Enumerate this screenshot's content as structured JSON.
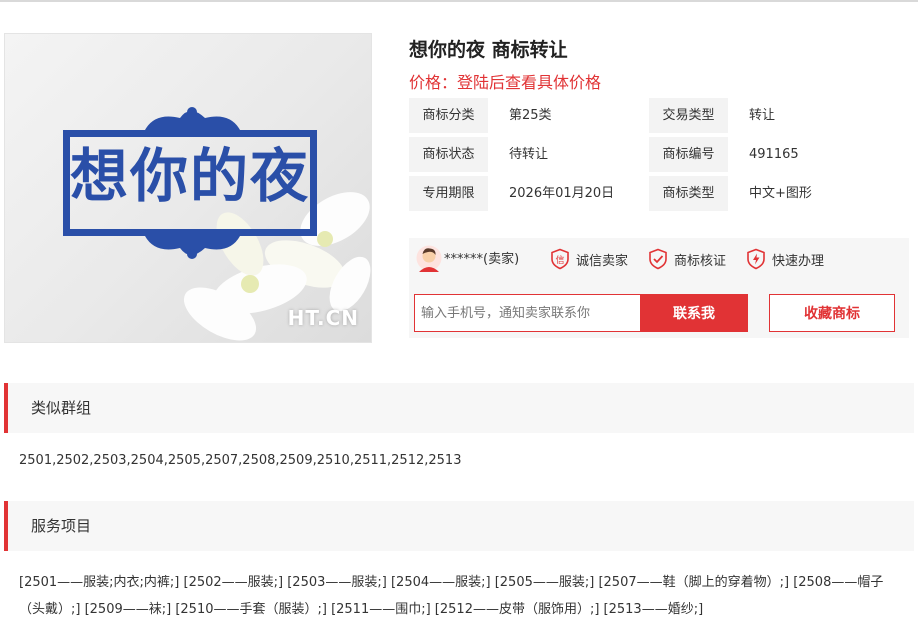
{
  "product": {
    "logo_text": "想你的夜",
    "watermark": "HT.CN",
    "title": "想你的夜 商标转让",
    "price_label": "价格：",
    "price_value": "登陆后查看具体价格"
  },
  "attributes": [
    [
      {
        "label": "商标分类",
        "value": "第25类"
      },
      {
        "label": "交易类型",
        "value": "转让"
      }
    ],
    [
      {
        "label": "商标状态",
        "value": "待转让"
      },
      {
        "label": "商标编号",
        "value": "491165"
      }
    ],
    [
      {
        "label": "专用期限",
        "value": "2026年01月20日"
      },
      {
        "label": "商标类型",
        "value": "中文+图形"
      }
    ]
  ],
  "seller": {
    "name": "******(卖家)",
    "badges": [
      {
        "icon": "credit-shield-icon",
        "label": "诚信卖家"
      },
      {
        "icon": "check-shield-icon",
        "label": "商标核证"
      },
      {
        "icon": "lightning-shield-icon",
        "label": "快速办理"
      }
    ]
  },
  "contact": {
    "placeholder": "输入手机号，通知卖家联系你",
    "contact_button": "联系我",
    "favorite_button": "收藏商标"
  },
  "similar_groups": {
    "title": "类似群组",
    "text": "2501,2502,2503,2504,2505,2507,2508,2509,2510,2511,2512,2513"
  },
  "services": {
    "title": "服务项目",
    "text": "[2501——服装;内衣;内裤;] [2502——服装;] [2503——服装;] [2504——服装;] [2505——服装;] [2507——鞋（脚上的穿着物）;] [2508——帽子（头戴）;] [2509——袜;] [2510——手套（服装）;] [2511——围巾;] [2512——皮带（服饰用）;] [2513——婚纱;]"
  },
  "colors": {
    "accent": "#e13335",
    "logo_blue": "#2a4fa8"
  }
}
